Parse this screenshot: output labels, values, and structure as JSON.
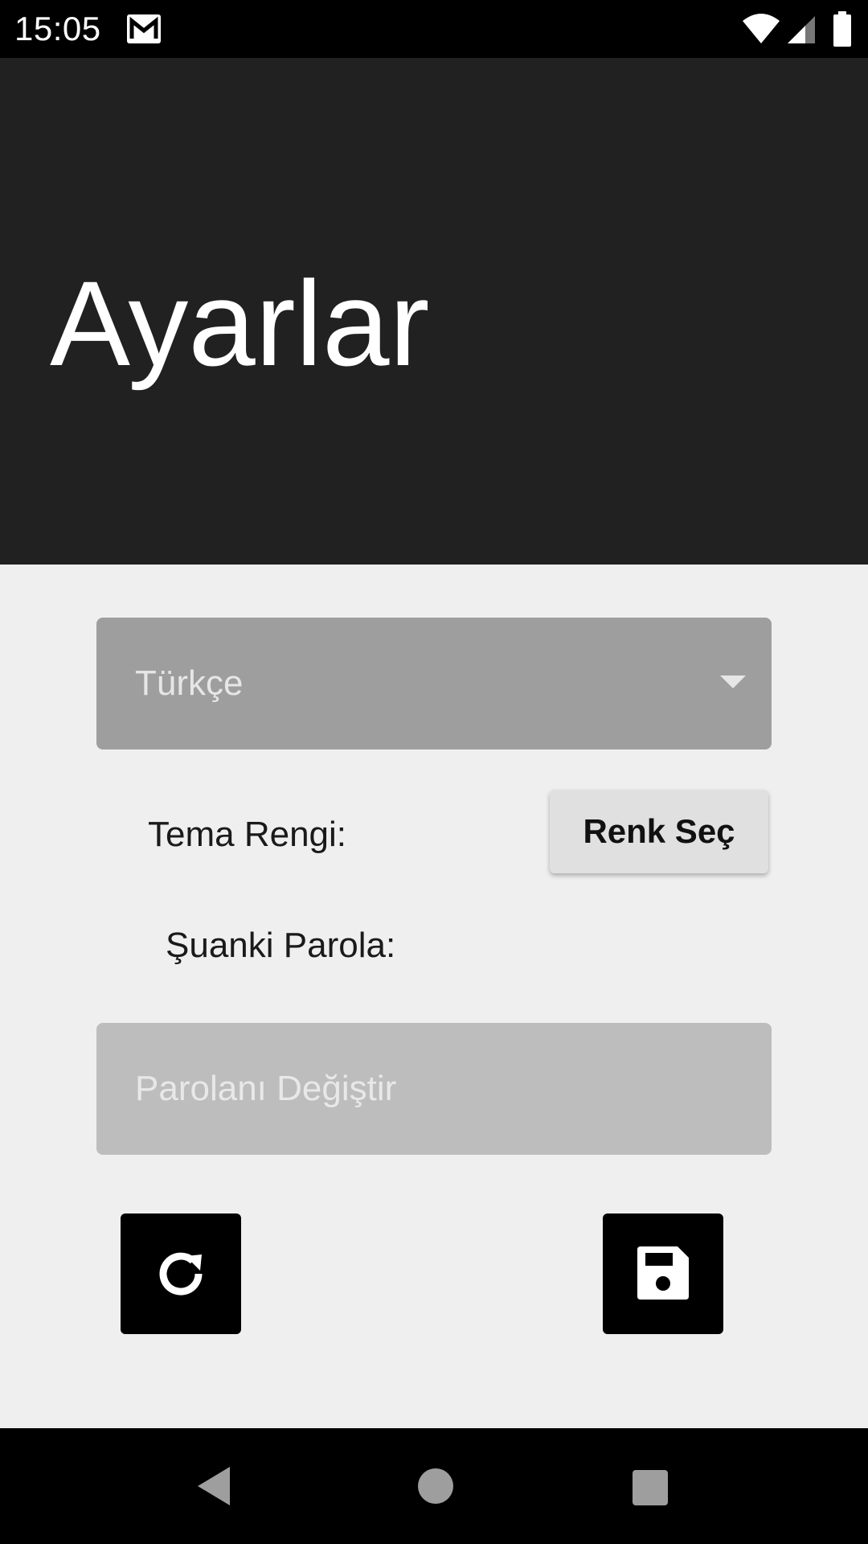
{
  "status_bar": {
    "time": "15:05",
    "icons": [
      "gmail-icon",
      "wifi-icon",
      "signal-icon",
      "battery-icon"
    ]
  },
  "header": {
    "title": "Ayarlar",
    "background_color": "#212121"
  },
  "language_spinner": {
    "selected_value": "Türkçe"
  },
  "theme": {
    "label": "Tema Rengi:",
    "button_label": "Renk Seç"
  },
  "password": {
    "current_label": "Şuanki Parola:",
    "placeholder": "Parolanı Değiştir"
  },
  "actions": {
    "refresh_icon": "refresh-icon",
    "save_icon": "save-icon"
  },
  "nav_bar": {
    "icons": [
      "back-icon",
      "home-icon",
      "recent-apps-icon"
    ]
  }
}
